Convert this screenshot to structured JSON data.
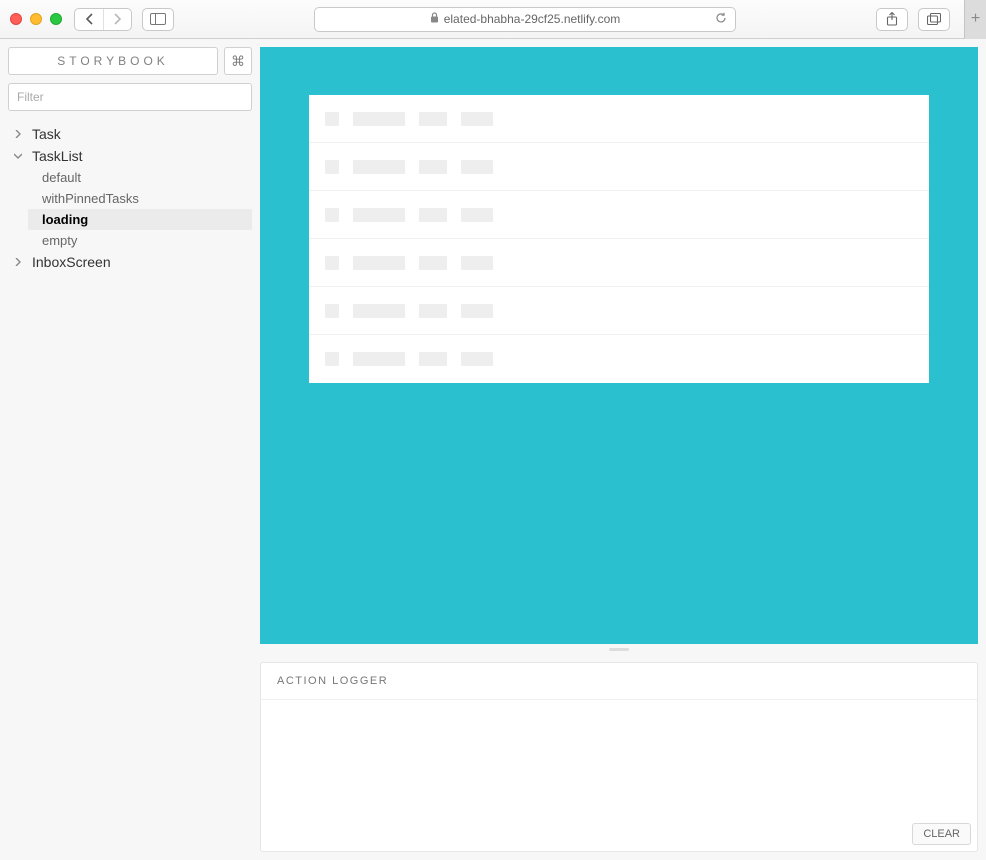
{
  "browser": {
    "url": "elated-bhabha-29cf25.netlify.com"
  },
  "sidebar": {
    "title": "STORYBOOK",
    "filter_placeholder": "Filter",
    "tree": [
      {
        "label": "Task",
        "expanded": false,
        "children": []
      },
      {
        "label": "TaskList",
        "expanded": true,
        "children": [
          {
            "label": "default",
            "selected": false
          },
          {
            "label": "withPinnedTasks",
            "selected": false
          },
          {
            "label": "loading",
            "selected": true
          },
          {
            "label": "empty",
            "selected": false
          }
        ]
      },
      {
        "label": "InboxScreen",
        "expanded": false,
        "children": []
      }
    ]
  },
  "preview": {
    "background": "#2bc0cf",
    "loading_rows": 6
  },
  "action_panel": {
    "title": "ACTION LOGGER",
    "clear_label": "CLEAR"
  }
}
